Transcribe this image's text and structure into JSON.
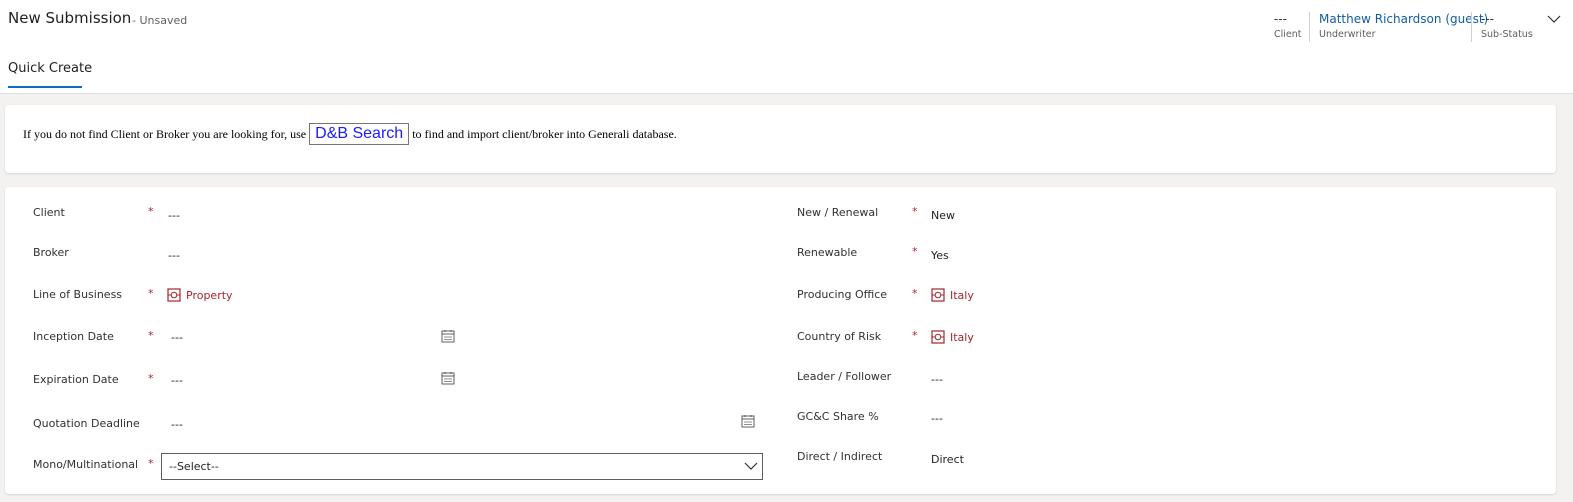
{
  "header": {
    "title": "New Submission",
    "status": "- Unsaved",
    "client": {
      "value": "---",
      "label": "Client"
    },
    "underwriter": {
      "value": "Matthew Richardson (guest)",
      "label": "Underwriter"
    },
    "substatus": {
      "value": "---",
      "label": "Sub-Status"
    }
  },
  "tabs": [
    {
      "label": "Quick Create",
      "active": true
    }
  ],
  "info": {
    "before": "If you do not find Client or Broker you are looking for, use",
    "button": "D&B Search",
    "after": "to find and import client/broker into Generali database."
  },
  "form": {
    "left": [
      {
        "label": "Client",
        "required": true,
        "value": "---"
      },
      {
        "label": "Broker",
        "required": false,
        "value": "---"
      },
      {
        "label": "Line of Business",
        "required": true,
        "value": "Property",
        "lookup": true
      },
      {
        "label": "Inception Date",
        "required": true,
        "value": "---",
        "icon": "calendar-icon"
      },
      {
        "label": "Expiration Date",
        "required": true,
        "value": "---",
        "icon": "calendar-icon"
      },
      {
        "label": "Quotation Deadline",
        "required": false,
        "value": "---",
        "icon": "calendar-icon"
      },
      {
        "label": "Mono/Multinational",
        "required": true,
        "value": "--Select--",
        "type": "select"
      }
    ],
    "right": [
      {
        "label": "New / Renewal",
        "required": true,
        "value": "New"
      },
      {
        "label": "Renewable",
        "required": true,
        "value": "Yes"
      },
      {
        "label": "Producing Office",
        "required": true,
        "value": "Italy",
        "lookup": true
      },
      {
        "label": "Country of Risk",
        "required": true,
        "value": "Italy",
        "lookup": true
      },
      {
        "label": "Leader / Follower",
        "required": false,
        "value": "---"
      },
      {
        "label": "GC&C Share %",
        "required": false,
        "value": "---"
      },
      {
        "label": "Direct / Indirect",
        "required": false,
        "value": "Direct"
      }
    ],
    "required_marker": "*"
  },
  "colors": {
    "accent": "#0f6cbd",
    "required": "#a4262c",
    "link": "#115ea3",
    "dnb_button_text": "#1a1aff"
  }
}
